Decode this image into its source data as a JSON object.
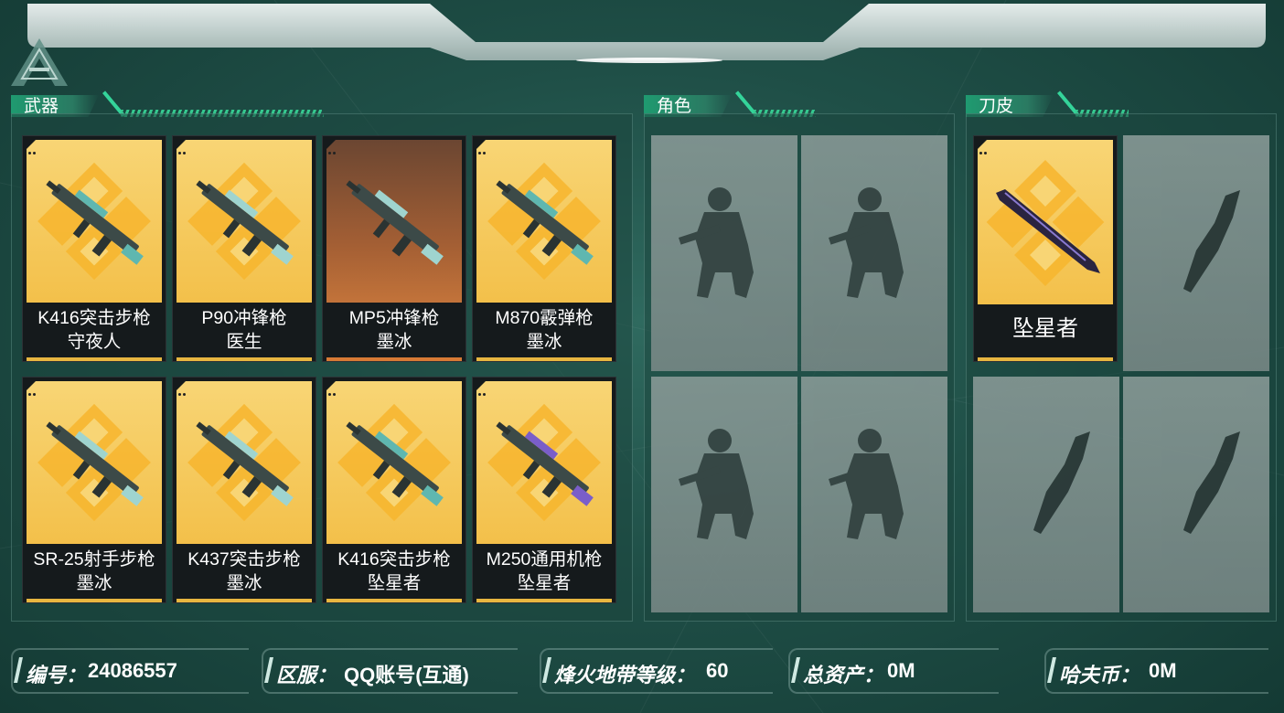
{
  "sections": {
    "weapons": "武器",
    "characters": "角色",
    "knife_skins": "刀皮"
  },
  "weapons": [
    {
      "line1": "K416突击步枪",
      "line2": "守夜人",
      "rarity": "gold",
      "weapon_icon": "assault-rifle-icon"
    },
    {
      "line1": "P90冲锋枪",
      "line2": "医生",
      "rarity": "gold",
      "weapon_icon": "smg-icon"
    },
    {
      "line1": "MP5冲锋枪",
      "line2": "墨冰",
      "rarity": "orange",
      "weapon_icon": "smg-icon"
    },
    {
      "line1": "M870霰弹枪",
      "line2": "墨冰",
      "rarity": "gold",
      "weapon_icon": "shotgun-icon"
    },
    {
      "line1": "SR-25射手步枪",
      "line2": "墨冰",
      "rarity": "gold",
      "weapon_icon": "marksman-rifle-icon"
    },
    {
      "line1": "K437突击步枪",
      "line2": "墨冰",
      "rarity": "gold",
      "weapon_icon": "assault-rifle-icon"
    },
    {
      "line1": "K416突击步枪",
      "line2": "坠星者",
      "rarity": "gold",
      "weapon_icon": "assault-rifle-icon"
    },
    {
      "line1": "M250通用机枪",
      "line2": "坠星者",
      "rarity": "gold",
      "weapon_icon": "machine-gun-icon"
    }
  ],
  "knife_card": {
    "name": "坠星者",
    "rarity": "gold",
    "icon": "knife-icon"
  },
  "info": {
    "id_label": "编号：",
    "id_value": "24086557",
    "server_label": "区服：",
    "server_value": "QQ账号(互通)",
    "level_label": "烽火地带等级：",
    "level_value": "60",
    "assets_label": "总资产：",
    "assets_value": "0M",
    "coin_label": "哈夫币：",
    "coin_value": "0M"
  },
  "colors": {
    "gold_card": "#f3c04a",
    "orange_card": "#a45f34",
    "accent_green": "#34d49a",
    "background": "#1f4f47"
  }
}
